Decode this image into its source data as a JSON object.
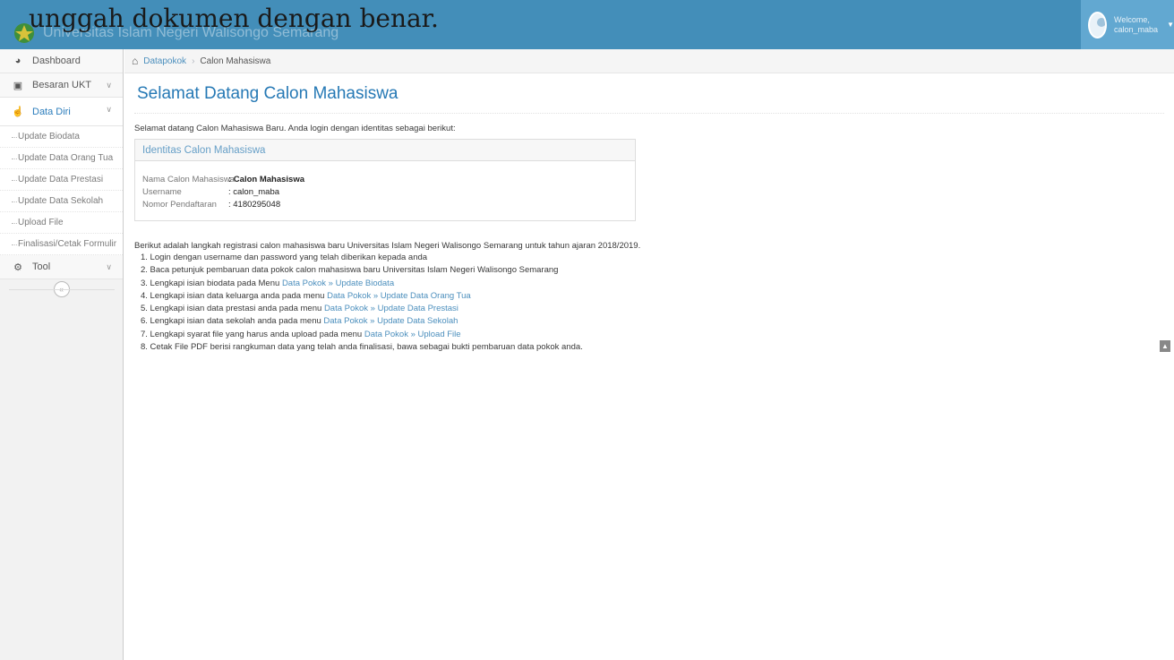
{
  "overlay": {
    "text": "unggah dokumen dengan benar."
  },
  "navbar": {
    "brand_text": "Universitas Islam Negeri Walisongo Semarang",
    "logo_icon": "uin-logo-icon",
    "user_welcome": "Welcome,",
    "user_name": "calon_maba"
  },
  "sidebar": {
    "items": [
      {
        "label": "Dashboard",
        "icon": "dashboard-icon"
      },
      {
        "label": "Besaran UKT",
        "icon": "money-icon"
      },
      {
        "label": "Data Diri",
        "icon": "hand-icon"
      },
      {
        "label": "Tool",
        "icon": "cogs-icon"
      }
    ],
    "submenu": [
      "Update Biodata",
      "Update Data Orang Tua",
      "Update Data Prestasi",
      "Update Data Sekolah",
      "Upload File",
      "Finalisasi/Cetak Formulir"
    ]
  },
  "breadcrumb": {
    "home": "Datapokok",
    "current": "Calon Mahasiswa"
  },
  "main": {
    "title": "Selamat Datang Calon Mahasiswa",
    "intro": "Selamat datang Calon Mahasiswa Baru. Anda login dengan identitas sebagai berikut:",
    "widget": {
      "title": "Identitas Calon Mahasiswa",
      "rows": [
        {
          "label": "Nama Calon Mahasiswa",
          "value": ": Calon Mahasiswa"
        },
        {
          "label": "Username",
          "value": ": calon_maba"
        },
        {
          "label": "Nomor Pendaftaran",
          "value": ": 4180295048"
        }
      ]
    },
    "steps_intro": "Berikut adalah langkah registrasi calon mahasiswa baru Universitas Islam Negeri Walisongo Semarang untuk tahun ajaran 2018/2019.",
    "steps": [
      {
        "text": "1. Login dengan username dan password yang telah diberikan kepada anda",
        "link": ""
      },
      {
        "text": "2. Baca petunjuk pembaruan data pokok calon mahasiswa baru Universitas Islam Negeri Walisongo Semarang",
        "link": ""
      },
      {
        "text": "3. Lengkapi isian biodata pada Menu ",
        "link": "Data Pokok » Update Biodata"
      },
      {
        "text": "4. Lengkapi isian data keluarga anda pada menu ",
        "link": "Data Pokok » Update Data Orang Tua"
      },
      {
        "text": "5. Lengkapi isian data prestasi anda pada menu ",
        "link": "Data Pokok » Update Data Prestasi"
      },
      {
        "text": "6. Lengkapi isian data sekolah anda pada menu ",
        "link": "Data Pokok » Update Data Sekolah"
      },
      {
        "text": "7. Lengkapi syarat file yang harus anda upload pada menu ",
        "link": "Data Pokok » Upload File"
      },
      {
        "text": "8. Cetak File PDF berisi rangkuman data yang telah anda finalisasi, bawa sebagai bukti pembaruan data pokok anda.",
        "link": ""
      }
    ]
  },
  "colors": {
    "navbar": "#438eb9",
    "accent": "#2679b5",
    "link": "#4c8fbd"
  }
}
